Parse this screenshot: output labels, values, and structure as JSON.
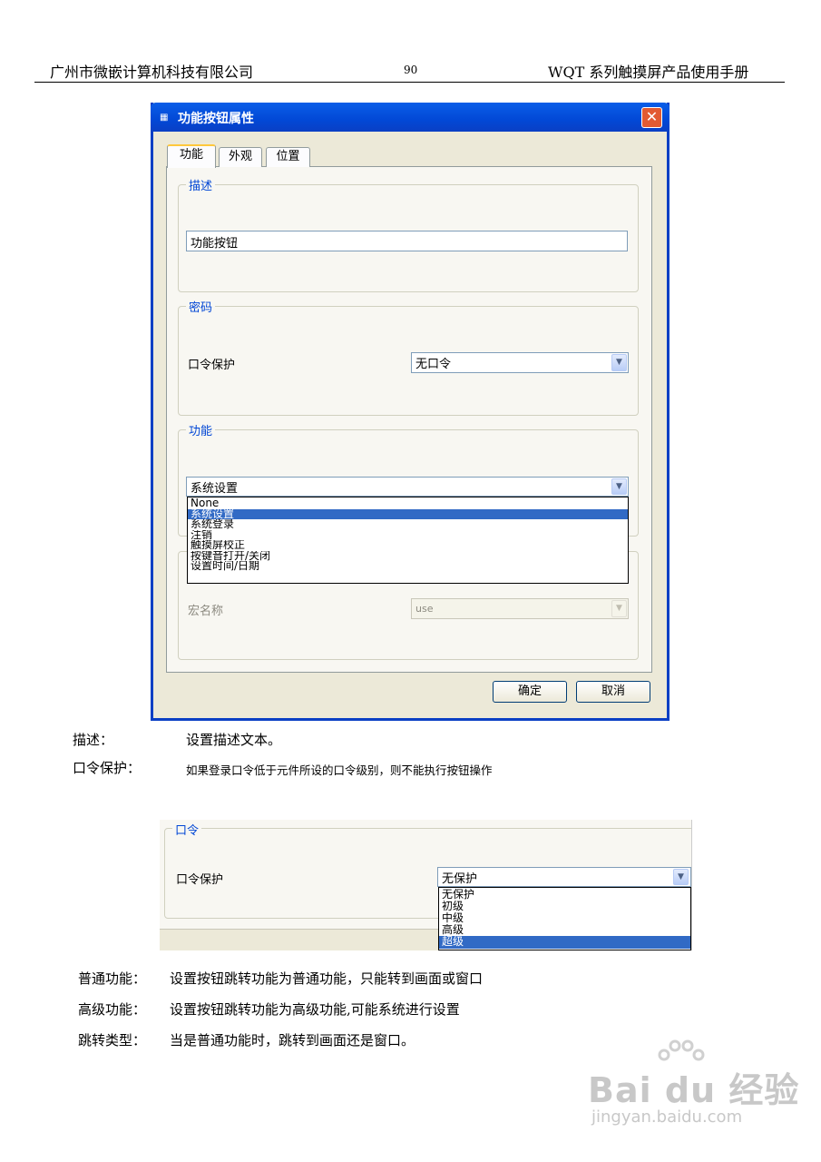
{
  "header": {
    "company": "广州市微嵌计算机科技有限公司",
    "page_number": "90",
    "manual_title": "WQT 系列触摸屏产品使用手册"
  },
  "dialog": {
    "title": "功能按钮属性",
    "close_glyph": "✕",
    "tabs": [
      {
        "label": "功能",
        "active": true
      },
      {
        "label": "外观",
        "active": false
      },
      {
        "label": "位置",
        "active": false
      }
    ],
    "description_group": {
      "label": "描述",
      "value": "功能按钮"
    },
    "password_group": {
      "label": "密码",
      "field_label": "口令保护",
      "value": "无口令"
    },
    "function_group": {
      "label": "功能",
      "value": "系统设置",
      "options": [
        "None",
        "系统设置",
        "系统登录",
        "注销",
        "触摸屏校正",
        "按键音打开/关闭",
        "设置时间/日期"
      ],
      "selected_index": 1
    },
    "macro_group": {
      "field_label": "宏名称",
      "value": "use"
    },
    "ok_label": "确定",
    "cancel_label": "取消"
  },
  "body": {
    "desc_term": "描述：",
    "desc_text": "设置描述文本。",
    "pw_term": "口令保护：",
    "pw_text": "如果登录口令低于元件所设的口令级别，则不能执行按钮操作"
  },
  "shot2": {
    "group_label": "口令",
    "field_label": "口令保护",
    "value": "无保护",
    "options": [
      "无保护",
      "初级",
      "中级",
      "高级",
      "超级"
    ],
    "selected_index": 4
  },
  "body2": {
    "items": [
      {
        "term": "普通功能：",
        "text": "设置按钮跳转功能为普通功能，只能转到画面或窗口"
      },
      {
        "term": "高级功能：",
        "text": "设置按钮跳转功能为高级功能,可能系统进行设置"
      },
      {
        "term": "跳转类型：",
        "text": "当是普通功能时，跳转到画面还是窗口。"
      }
    ]
  },
  "watermark": {
    "brand": "Bai du 经验",
    "url": "jingyan.baidu.com"
  },
  "colors": {
    "titlebar": "#0a5ee8",
    "selection": "#316ac5",
    "group_label": "#0046d5",
    "dialog_bg": "#ece9d8"
  }
}
